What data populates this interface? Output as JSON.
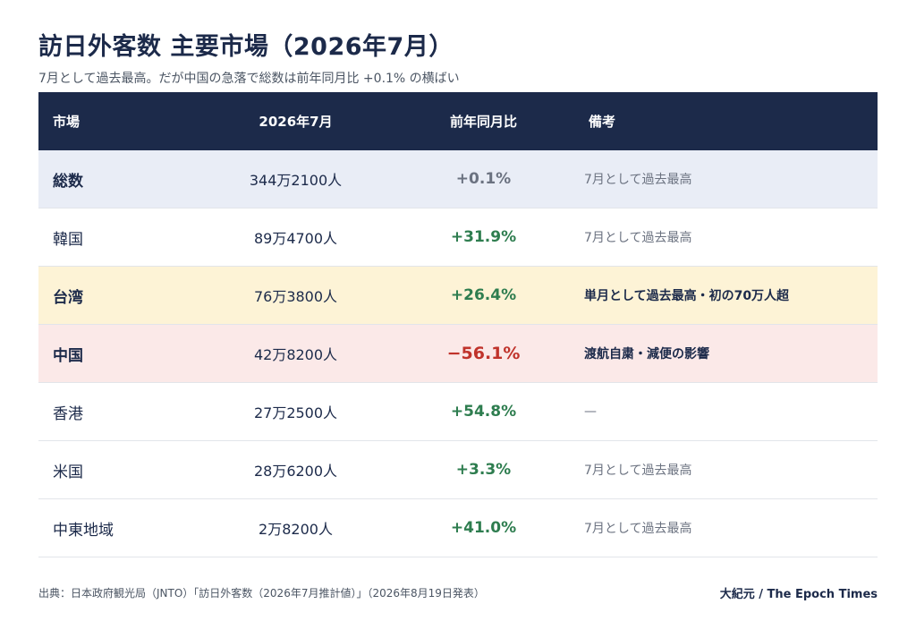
{
  "title": "訪日外客数 主要市場（2026年7月）",
  "subtitle": "7月として過去最高。だが中国の急落で総数は前年同月比 +0.1% の横ばい",
  "chart_data": {
    "type": "table",
    "columns": [
      "市場",
      "2026年7月",
      "前年同月比",
      "備考"
    ],
    "rows": [
      {
        "market": "総数",
        "visitors": "344万2100人",
        "yoy": "+0.1%",
        "yoy_value": 0.1,
        "note": "7月として過去最高",
        "bg": "#e9edf6",
        "yoy_color": "#6b7280"
      },
      {
        "market": "韓国",
        "visitors": "89万4700人",
        "yoy": "+31.9%",
        "yoy_value": 31.9,
        "note": "7月として過去最高",
        "bg": "#ffffff",
        "yoy_color": "#2e7d4f"
      },
      {
        "market": "台湾",
        "visitors": "76万3800人",
        "yoy": "+26.4%",
        "yoy_value": 26.4,
        "note": "単月として過去最高・初の70万人超",
        "bg": "#fdf3d6",
        "yoy_color": "#2e7d4f"
      },
      {
        "market": "中国",
        "visitors": "42万8200人",
        "yoy": "−56.1%",
        "yoy_value": -56.1,
        "note": "渡航自粛・減便の影響",
        "bg": "#fbe9e8",
        "yoy_color": "#c0332b"
      },
      {
        "market": "香港",
        "visitors": "27万2500人",
        "yoy": "+54.8%",
        "yoy_value": 54.8,
        "note": "—",
        "bg": "#ffffff",
        "yoy_color": "#2e7d4f"
      },
      {
        "market": "米国",
        "visitors": "28万6200人",
        "yoy": "+3.3%",
        "yoy_value": 3.3,
        "note": "7月として過去最高",
        "bg": "#ffffff",
        "yoy_color": "#2e7d4f"
      },
      {
        "market": "中東地域",
        "visitors": "2万8200人",
        "yoy": "+41.0%",
        "yoy_value": 41.0,
        "note": "7月として過去最高",
        "bg": "#ffffff",
        "yoy_color": "#2e7d4f"
      }
    ]
  },
  "source": "出典：日本政府観光局（JNTO）「訪日外客数（2026年7月推計値）」（2026年8月19日発表）",
  "credit": "大紀元 / The Epoch Times",
  "colors": {
    "header_bg": "#1c2a4a",
    "positive": "#2e7d4f",
    "negative": "#c0332b",
    "neutral": "#6b7280"
  }
}
